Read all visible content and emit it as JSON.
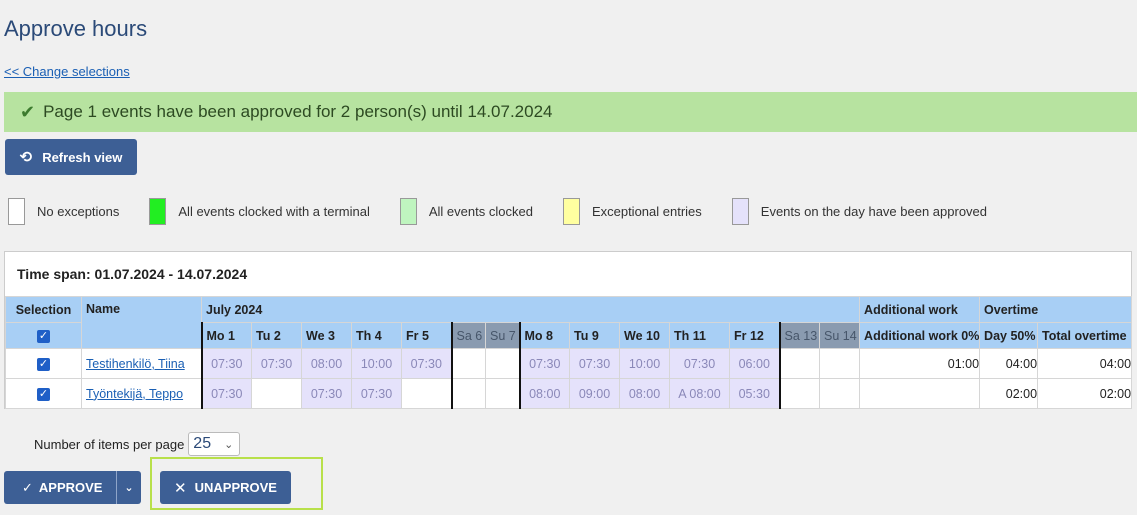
{
  "page": {
    "title": "Approve hours",
    "change_link": "<< Change selections"
  },
  "banner": {
    "message": "Page 1 events have been approved for 2 person(s) until 14.07.2024"
  },
  "toolbar": {
    "refresh_label": "Refresh view"
  },
  "legend": [
    {
      "label": "No exceptions",
      "color": "#ffffff"
    },
    {
      "label": "All events clocked with a terminal",
      "color": "#22ee22"
    },
    {
      "label": "All events clocked",
      "color": "#bff5bf"
    },
    {
      "label": "Exceptional entries",
      "color": "#ffffa0"
    },
    {
      "label": "Events on the day have been approved",
      "color": "#e5e2fb"
    }
  ],
  "timespan": "Time span: 01.07.2024 - 14.07.2024",
  "table": {
    "col_selection": "Selection",
    "col_name": "Name",
    "month": "July 2024",
    "group_additional": "Additional work",
    "group_overtime": "Overtime",
    "days": [
      "Mo 1",
      "Tu 2",
      "We 3",
      "Th 4",
      "Fr 5",
      "Sa 6",
      "Su 7",
      "Mo 8",
      "Tu 9",
      "We 10",
      "Th 11",
      "Fr 12",
      "Sa 13",
      "Su 14"
    ],
    "sub_additional": "Additional work 0%",
    "sub_day50": "Day 50%",
    "sub_total": "Total overtime",
    "rows": [
      {
        "name": "Testihenkilö, Tiina",
        "cells": [
          "07:30",
          "07:30",
          "08:00",
          "10:00",
          "07:30",
          "",
          "",
          "07:30",
          "07:30",
          "10:00",
          "07:30",
          "06:00",
          "",
          ""
        ],
        "additional": "01:00",
        "day50": "04:00",
        "total": "04:00"
      },
      {
        "name": "Työntekijä, Teppo",
        "cells": [
          "07:30",
          "",
          "07:30",
          "07:30",
          "",
          "",
          "",
          "08:00",
          "09:00",
          "08:00",
          "A 08:00",
          "05:30",
          "",
          ""
        ],
        "additional": "",
        "day50": "02:00",
        "total": "02:00"
      }
    ]
  },
  "pagination": {
    "label": "Number of items per page",
    "value": "25"
  },
  "actions": {
    "approve_label": "APPROVE",
    "unapprove_label": "UNAPPROVE"
  }
}
